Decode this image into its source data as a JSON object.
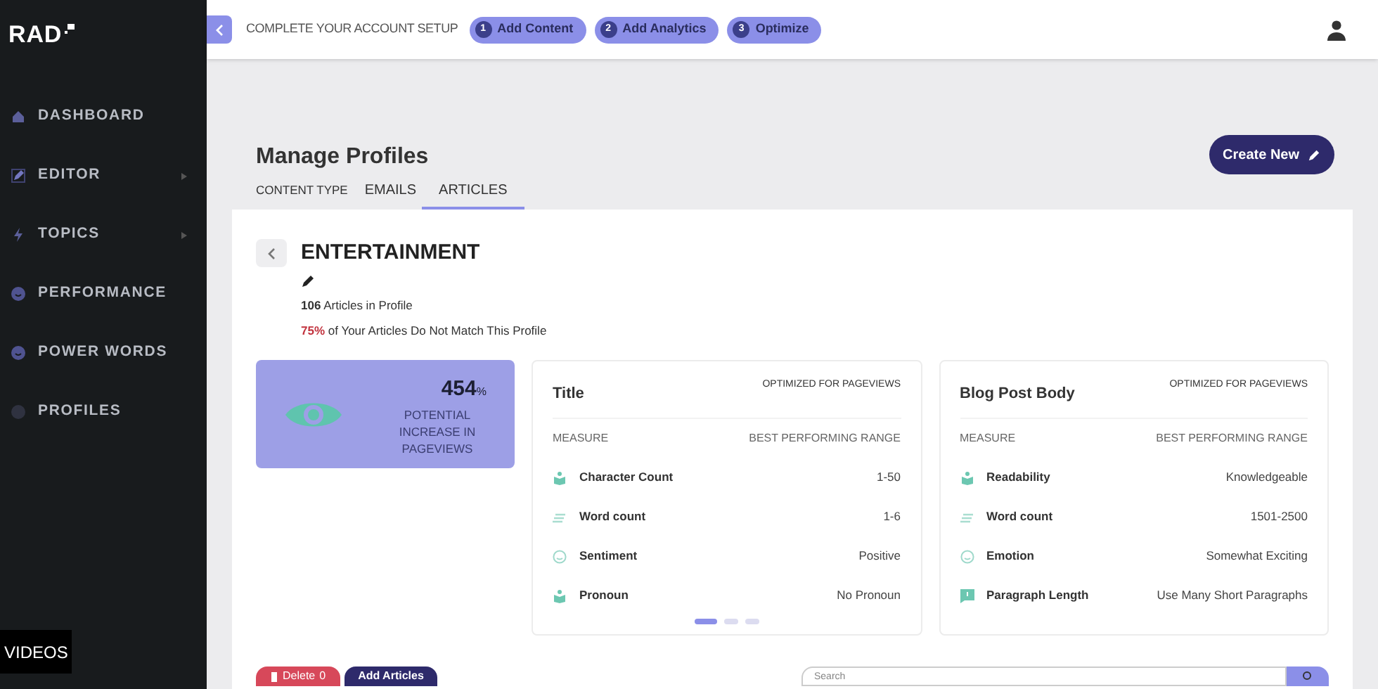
{
  "sidebar": {
    "logo": "RAD",
    "items": [
      {
        "label": "DASHBOARD",
        "kind": "home",
        "expandable": false
      },
      {
        "label": "EDITOR",
        "kind": "pencil",
        "expandable": true
      },
      {
        "label": "TOPICS",
        "kind": "bolt",
        "expandable": true
      },
      {
        "label": "PERFORMANCE",
        "kind": "smile",
        "expandable": false
      },
      {
        "label": "POWER WORDS",
        "kind": "smile",
        "expandable": false
      },
      {
        "label": "PROFILES",
        "kind": "dot",
        "expandable": false
      }
    ],
    "overlay": "VIDEOS"
  },
  "setup": {
    "label": "COMPLETE YOUR ACCOUNT SETUP",
    "steps": [
      {
        "number": "1",
        "label": "Add Content"
      },
      {
        "number": "2",
        "label": "Add Analytics"
      },
      {
        "number": "3",
        "label": "Optimize"
      }
    ]
  },
  "header": {
    "title": "Manage Profiles",
    "create_button": "Create New",
    "content_type_label": "CONTENT TYPE",
    "tabs": [
      {
        "label": "EMAILS",
        "selected": false
      },
      {
        "label": "ARTICLES",
        "selected": true
      }
    ]
  },
  "profile": {
    "name": "ENTERTAINMENT",
    "articles_count": "**106** Articles in Profile",
    "mismatch": "75%",
    "mismatch_text": "of Your Articles Do Not Match This Profile"
  },
  "highlight": {
    "value": "454",
    "unit": "%",
    "caption": "POTENTIAL INCREASE IN PAGEVIEWS"
  },
  "cards": [
    {
      "title": "Title",
      "tag": "OPTIMIZED FOR PAGEVIEWS",
      "col_measure": "MEASURE",
      "col_range": "BEST PERFORMING RANGE",
      "rows": [
        {
          "kind": "book",
          "measure": "Character Count",
          "range": "1-50"
        },
        {
          "kind": "lines",
          "measure": "Word count",
          "range": "1-6"
        },
        {
          "kind": "face",
          "measure": "Sentiment",
          "range": "Positive"
        },
        {
          "kind": "book",
          "measure": "Pronoun",
          "range": "No Pronoun"
        }
      ],
      "pages": [
        {
          "selected": true
        },
        {
          "selected": false
        },
        {
          "selected": false
        }
      ]
    },
    {
      "title": "Blog Post Body",
      "tag": "OPTIMIZED FOR PAGEVIEWS",
      "col_measure": "MEASURE",
      "col_range": "BEST PERFORMING RANGE",
      "rows": [
        {
          "kind": "book",
          "measure": "Readability",
          "range": "Knowledgeable"
        },
        {
          "kind": "lines",
          "measure": "Word count",
          "range": "1501-2500"
        },
        {
          "kind": "face",
          "measure": "Emotion",
          "range": "Somewhat Exciting"
        },
        {
          "kind": "flag",
          "measure": "Paragraph Length",
          "range": "Use Many Short Paragraphs"
        }
      ]
    }
  ],
  "actions": {
    "delete_label": "Delete",
    "delete_count": "0",
    "add_button": "Add Articles",
    "search_placeholder": "Search"
  }
}
